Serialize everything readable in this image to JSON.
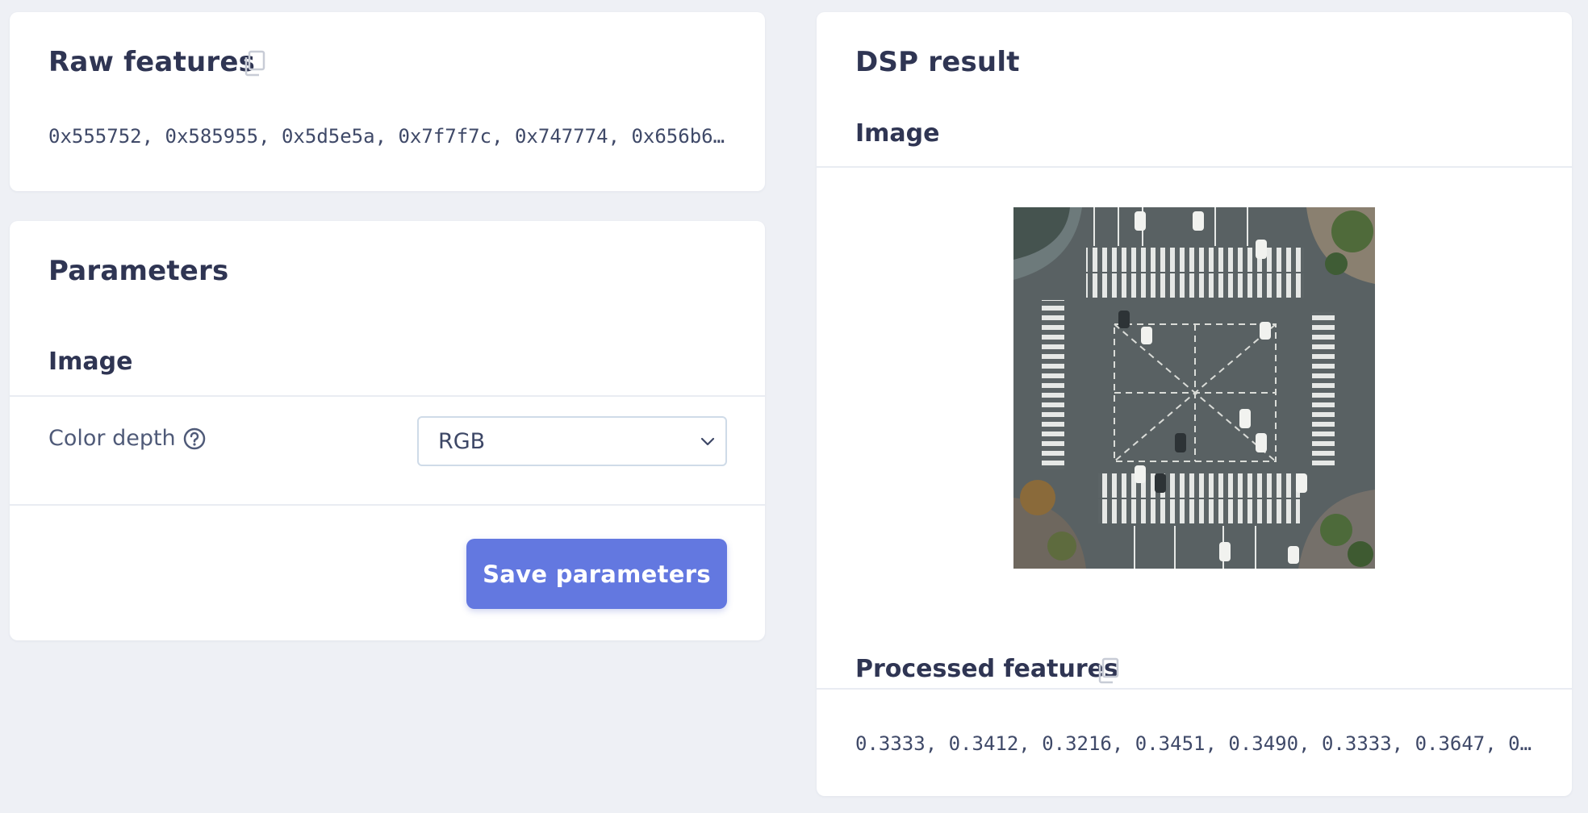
{
  "raw_features": {
    "title": "Raw features",
    "copy_icon": "copy-icon",
    "values": "0x555752, 0x585955, 0x5d5e5a, 0x7f7f7c, 0x747774, 0x656b6…"
  },
  "parameters": {
    "title": "Parameters",
    "section_title": "Image",
    "color_depth": {
      "label": "Color depth",
      "help_icon": "help-circle-icon",
      "selected": "RGB"
    },
    "save_label": "Save parameters",
    "accent": "#6378e0"
  },
  "dsp_result": {
    "title": "DSP result",
    "image_section_title": "Image",
    "image_description_icon": "aerial-intersection-image",
    "processed_title": "Processed features",
    "copy_icon": "copy-icon",
    "processed_values": "0.3333, 0.3412, 0.3216, 0.3451, 0.3490, 0.3333, 0.3647, 0…"
  }
}
